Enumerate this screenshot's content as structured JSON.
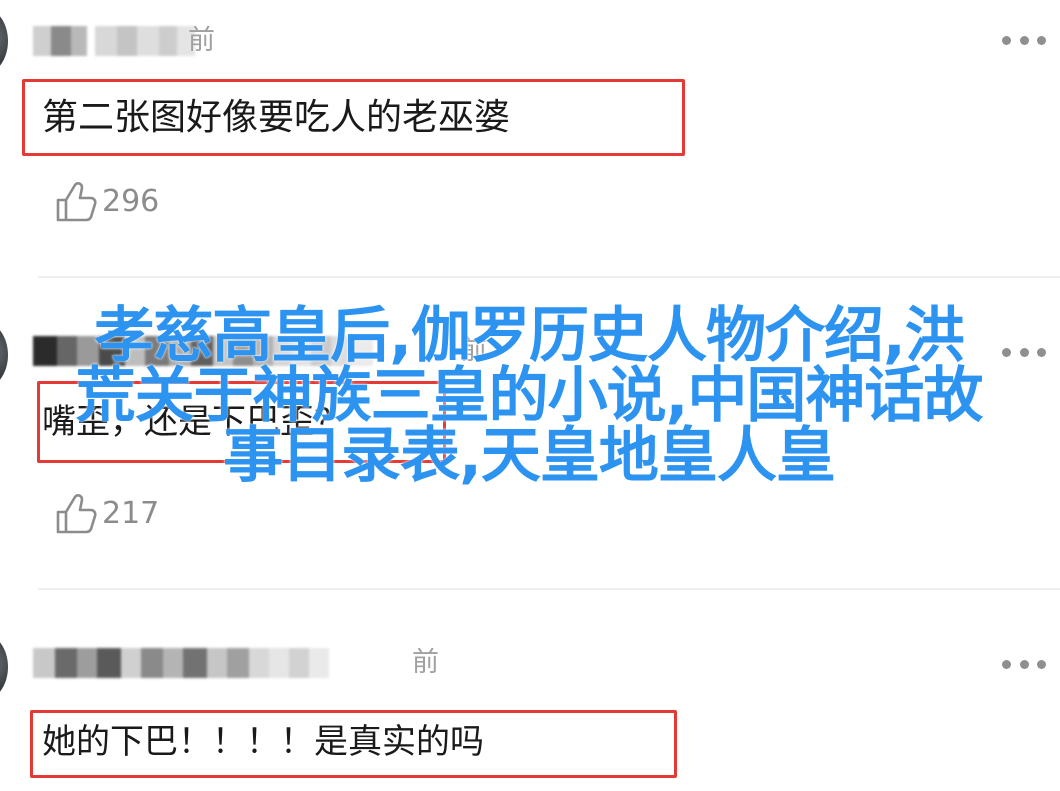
{
  "comments": [
    {
      "time_suffix": "前",
      "content": "第二张图好像要吃人的老巫婆",
      "likes": "296",
      "highlighted": true
    },
    {
      "time_suffix": "前",
      "content": "嘴歪，还是下巴歪？",
      "likes": "217",
      "highlighted": true
    },
    {
      "time_suffix": "前",
      "content": "她的下巴！！！！是真实的吗",
      "likes": "",
      "highlighted": true
    }
  ],
  "overlay": {
    "line1": "孝慈高皇后,伽罗历史人物介绍,洪",
    "line2": "荒关于神族三皇的小说,中国神话故",
    "line3": "事目录表,天皇地皇人皇"
  },
  "icons": {
    "more": "more-dots-icon",
    "like": "thumbs-up-icon"
  },
  "colors": {
    "highlight_border": "#e53935",
    "overlay_text": "#2c93f0",
    "meta_text": "#a0a0a0"
  }
}
